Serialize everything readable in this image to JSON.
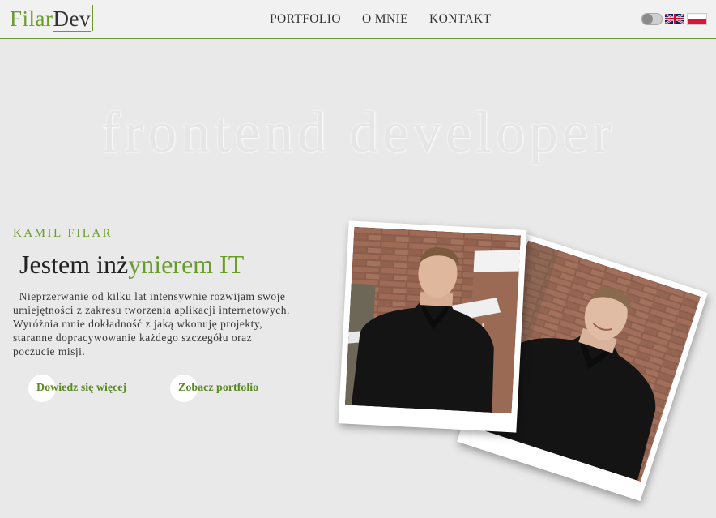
{
  "header": {
    "logo_part1": "Filar",
    "logo_part2": "Dev",
    "nav": [
      "PORTFOLIO",
      "O MNIE",
      "KONTAKT"
    ],
    "icons": {
      "theme_toggle": "toggle-switch-icon",
      "english": "uk-flag-icon",
      "polish": "poland-flag-icon"
    }
  },
  "hero": {
    "watermark": "frontend developer",
    "name": "KAMIL FILAR",
    "headline_plain": "Jestem inż",
    "headline_accent": "ynierem IT",
    "intro": "  Nieprzerwanie od kilku lat intensywnie rozwijam swoje umiejętności z zakresu tworzenia aplikacji internetowych. Wyróżnia mnie dokładność z jaką wkonuję projekty, staranne dopracywowanie każdego szczegółu oraz poczucie misji.",
    "buttons": {
      "more": "Dowiedz się więcej",
      "portfolio": "Zobacz portfolio"
    }
  },
  "colors": {
    "accent": "#6a9c2b",
    "background": "#e9e9e9",
    "header": "#f1f1f1"
  }
}
